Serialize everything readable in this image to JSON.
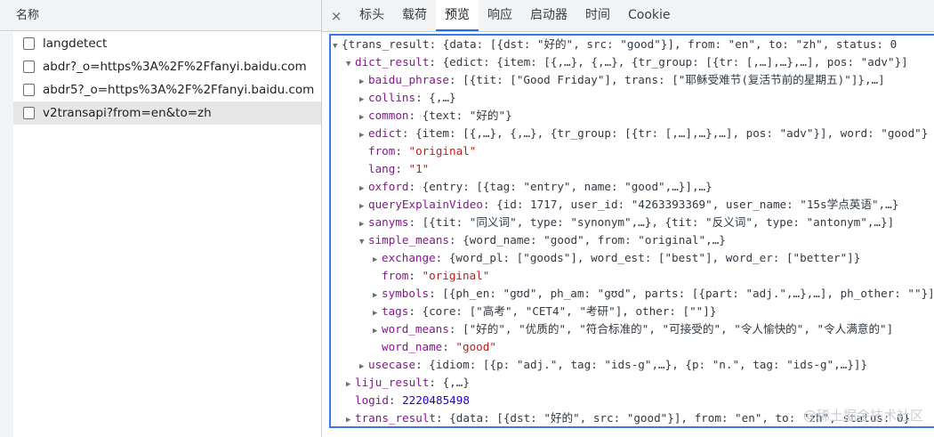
{
  "left": {
    "header": "名称",
    "items": [
      {
        "label": "langdetect"
      },
      {
        "label": "abdr?_o=https%3A%2F%2Ffanyi.baidu.com"
      },
      {
        "label": "abdr5?_o=https%3A%2F%2Ffanyi.baidu.com"
      },
      {
        "label": "v2transapi?from=en&to=zh"
      }
    ]
  },
  "tabs": {
    "close": "×",
    "items": [
      "标头",
      "载荷",
      "预览",
      "响应",
      "启动器",
      "时间",
      "Cookie"
    ],
    "active": "预览"
  },
  "preview": {
    "lines": [
      {
        "indent": 0,
        "tri": "▼",
        "key": "",
        "value": "{trans_result: {data: [{dst: \"好的\", src: \"good\"}], from: \"en\", to: \"zh\", status: 0"
      },
      {
        "indent": 1,
        "tri": "▼",
        "key": "dict_result",
        "value": "{edict: {item: [{,…}, {,…}, {tr_group: [{tr: [,…],…},…], pos: \"adv\"}]"
      },
      {
        "indent": 2,
        "tri": "▶",
        "key": "baidu_phrase",
        "value": "[{tit: [\"Good Friday\"], trans: [\"耶稣受难节(复活节前的星期五)\"]},…]"
      },
      {
        "indent": 2,
        "tri": "▶",
        "key": "collins",
        "value": "{,…}"
      },
      {
        "indent": 2,
        "tri": "▶",
        "key": "common",
        "value": "{text: \"好的\"}"
      },
      {
        "indent": 2,
        "tri": "▶",
        "key": "edict",
        "value": "{item: [{,…}, {,…}, {tr_group: [{tr: [,…],…},…], pos: \"adv\"}], word: \"good\"}"
      },
      {
        "indent": 2,
        "tri": "",
        "key": "from",
        "value": "\"original\"",
        "type": "s"
      },
      {
        "indent": 2,
        "tri": "",
        "key": "lang",
        "value": "\"1\"",
        "type": "s"
      },
      {
        "indent": 2,
        "tri": "▶",
        "key": "oxford",
        "value": "{entry: [{tag: \"entry\", name: \"good\",…}],…}"
      },
      {
        "indent": 2,
        "tri": "▶",
        "key": "queryExplainVideo",
        "value": "{id: 1717, user_id: \"4263393369\", user_name: \"15s学点英语\",…}"
      },
      {
        "indent": 2,
        "tri": "▶",
        "key": "sanyms",
        "value": "[{tit: \"同义词\", type: \"synonym\",…}, {tit: \"反义词\", type: \"antonym\",…}]"
      },
      {
        "indent": 2,
        "tri": "▼",
        "key": "simple_means",
        "value": "{word_name: \"good\", from: \"original\",…}"
      },
      {
        "indent": 3,
        "tri": "▶",
        "key": "exchange",
        "value": "{word_pl: [\"goods\"], word_est: [\"best\"], word_er: [\"better\"]}"
      },
      {
        "indent": 3,
        "tri": "",
        "key": "from",
        "value": "\"original\"",
        "type": "s"
      },
      {
        "indent": 3,
        "tri": "▶",
        "key": "symbols",
        "value": "[{ph_en: \"gʊd\", ph_am: \"gʊd\", parts: [{part: \"adj.\",…},…], ph_other: \"\"}]"
      },
      {
        "indent": 3,
        "tri": "▶",
        "key": "tags",
        "value": "{core: [\"高考\", \"CET4\", \"考研\"], other: [\"\"]}"
      },
      {
        "indent": 3,
        "tri": "▶",
        "key": "word_means",
        "value": "[\"好的\", \"优质的\", \"符合标准的\", \"可接受的\", \"令人愉快的\", \"令人满意的\"]"
      },
      {
        "indent": 3,
        "tri": "",
        "key": "word_name",
        "value": "\"good\"",
        "type": "s"
      },
      {
        "indent": 2,
        "tri": "▶",
        "key": "usecase",
        "value": "{idiom: [{p: \"adj.\", tag: \"ids-g\",…}, {p: \"n.\", tag: \"ids-g\",…}]}"
      },
      {
        "indent": 1,
        "tri": "▶",
        "key": "liju_result",
        "value": "{,…}"
      },
      {
        "indent": 1,
        "tri": "",
        "key": "logid",
        "value": "2220485498",
        "type": "n"
      },
      {
        "indent": 1,
        "tri": "▶",
        "key": "trans_result",
        "value": "{data: [{dst: \"好的\", src: \"good\"}], from: \"en\", to: \"zh\", status: 0}"
      }
    ]
  },
  "watermark": "@稀土掘金技术社区"
}
